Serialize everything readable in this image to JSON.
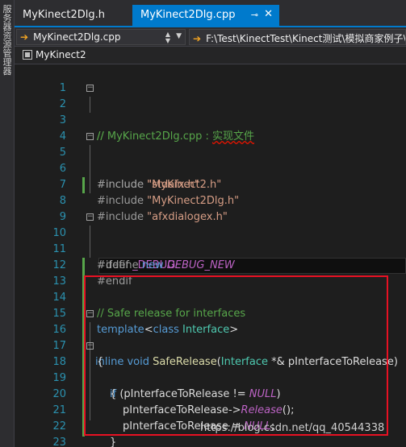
{
  "side_panel": {
    "label": "服务器资源管理器"
  },
  "tabs": [
    {
      "label": "MyKinect2Dlg.h",
      "active": false
    },
    {
      "label": "MyKinect2Dlg.cpp",
      "active": true,
      "pin": "⊸",
      "close": "✕"
    }
  ],
  "nav": {
    "file_combo": "MyKinect2Dlg.cpp",
    "path_combo": "F:\\Test\\KinectTest\\Kinect测试\\模拟商家例子\\"
  },
  "scope": {
    "label": "MyKinect2"
  },
  "editor": {
    "line_numbers": [
      "1",
      "2",
      "3",
      "4",
      "5",
      "6",
      "7",
      "8",
      "9",
      "10",
      "11",
      "12",
      "13",
      "14",
      "15",
      "16",
      "17",
      "18",
      "19",
      "20",
      "21",
      "22",
      "23",
      "24"
    ],
    "l2_comment": "// MyKinect2Dlg.cpp : ",
    "l2_comment_cn": "实现文件",
    "l3_comment": "//",
    "inc_kw": "#include",
    "inc1": "\"stdafx.h\"",
    "inc2": "\"MyKinect2.h\"",
    "inc3": "\"MyKinect2Dlg.h\"",
    "inc4": "\"afxdialogex.h\"",
    "ifdef": "#ifdef",
    "debug_macro": "_DEBUG",
    "define": "#define",
    "new_kw": "new",
    "debug_new": "DEBUG_NEW",
    "endif": "#endif",
    "l14_comment": "// Safe release for interfaces",
    "template_kw": "template",
    "class_kw": "class",
    "interface_type": "Interface",
    "inline_kw": "inline",
    "void_kw": "void",
    "func_name": "SafeRelease",
    "param": "pInterfaceToRelease",
    "if_kw": "if",
    "null_const": "NULL",
    "release_fn": "Release"
  },
  "watermark": "https://blog.csdn.net/qq_40544338"
}
